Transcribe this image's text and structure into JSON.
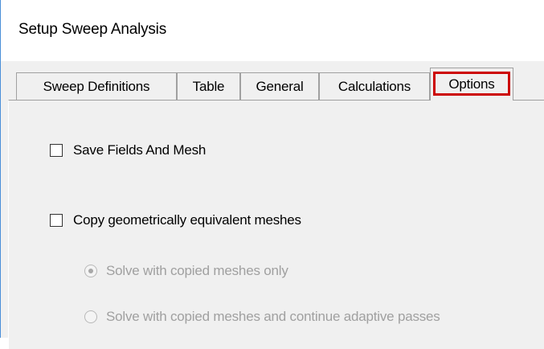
{
  "window": {
    "title": "Setup Sweep Analysis"
  },
  "tabs": [
    {
      "label": "Sweep Definitions",
      "selected": false
    },
    {
      "label": "Table",
      "selected": false
    },
    {
      "label": "General",
      "selected": false
    },
    {
      "label": "Calculations",
      "selected": false
    },
    {
      "label": "Options",
      "selected": true,
      "highlight_color": "#cc0000"
    }
  ],
  "options": {
    "save_fields": {
      "label": "Save Fields And Mesh",
      "checked": false
    },
    "copy_meshes": {
      "label": "Copy geometrically equivalent meshes",
      "checked": false
    },
    "solve_copied_only": {
      "label": "Solve with copied meshes only",
      "selected": true,
      "enabled": false
    },
    "solve_copied_continue": {
      "label": "Solve with copied meshes and continue adaptive passes",
      "selected": false,
      "enabled": false
    }
  }
}
